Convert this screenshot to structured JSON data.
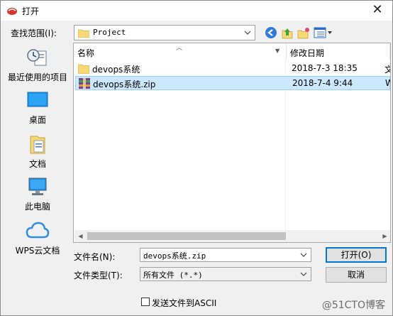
{
  "window": {
    "title": "打开",
    "close_glyph": "✕"
  },
  "lookin": {
    "label": "查找范围(I):",
    "value": "Project"
  },
  "places": [
    {
      "label": "最近使用的项目",
      "icon": "recent-items-icon"
    },
    {
      "label": "桌面",
      "icon": "desktop-icon"
    },
    {
      "label": "文档",
      "icon": "documents-icon"
    },
    {
      "label": "此电脑",
      "icon": "computer-icon"
    },
    {
      "label": "WPS云文档",
      "icon": "cloud-icon"
    }
  ],
  "list": {
    "columns": {
      "name": "名称",
      "date": "修改日期"
    },
    "rows": [
      {
        "name": "devops系统",
        "date": "2018-7-3 18:35",
        "more": "文",
        "icon": "folder-icon",
        "selected": false
      },
      {
        "name": "devops系统.zip",
        "date": "2018-7-4 9:44",
        "more": "W",
        "icon": "zip-archive-icon",
        "selected": true
      }
    ]
  },
  "filename": {
    "label": "文件名(N):",
    "value": "devops系统.zip"
  },
  "filetype": {
    "label": "文件类型(T):",
    "value": "所有文件 (*.*)"
  },
  "buttons": {
    "open": "打开(O)",
    "cancel": "取消"
  },
  "ascii": {
    "label": "发送文件到ASCII"
  },
  "watermark": {
    "text": "@51CTO博客"
  },
  "colors": {
    "selection": "#cce8ff",
    "default_button_border": "#0078d7"
  }
}
